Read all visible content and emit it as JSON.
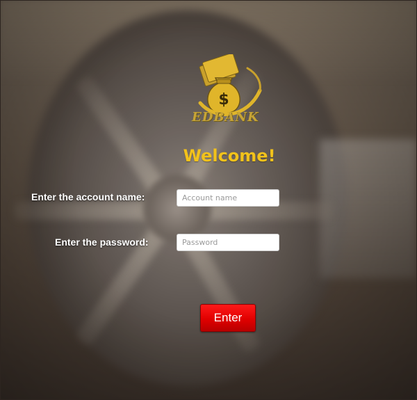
{
  "brand": {
    "name": "EDBANK",
    "logo_icon": "money-bag-icon",
    "logo_color": "#e0b52a"
  },
  "welcome": "Welcome!",
  "form": {
    "account_label": "Enter the account name:",
    "account_placeholder": "Account name",
    "account_value": "",
    "password_label": "Enter the password:",
    "password_placeholder": "Password",
    "password_value": "",
    "submit_label": "Enter"
  },
  "colors": {
    "welcome": "#f2c21b",
    "button": "#e00000",
    "label": "#ffffff"
  }
}
